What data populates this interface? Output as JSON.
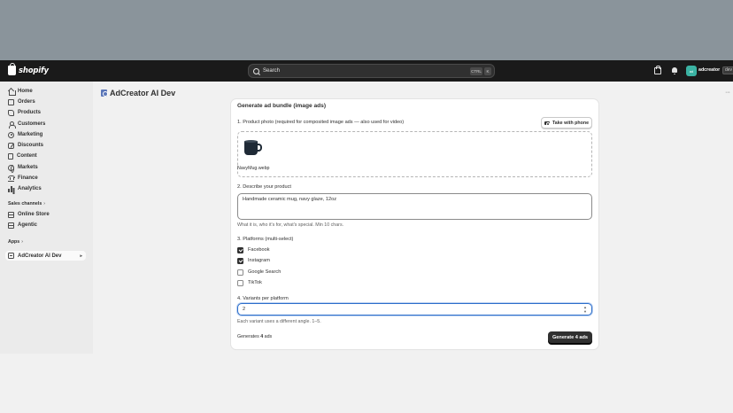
{
  "topbar": {
    "brand": "shopify",
    "search_label": "Search",
    "shortcut_mod": "CTRL",
    "shortcut_key": "K",
    "avatar_initials": "ad",
    "username": "adcreator",
    "env_badge": "dev"
  },
  "sidebar": {
    "items": [
      {
        "label": "Home",
        "icon": "home-icon"
      },
      {
        "label": "Orders",
        "icon": "orders-icon"
      },
      {
        "label": "Products",
        "icon": "tag-icon"
      },
      {
        "label": "Customers",
        "icon": "person-icon"
      },
      {
        "label": "Marketing",
        "icon": "target-icon"
      },
      {
        "label": "Discounts",
        "icon": "discount-icon"
      },
      {
        "label": "Content",
        "icon": "document-icon"
      },
      {
        "label": "Markets",
        "icon": "globe-icon"
      },
      {
        "label": "Finance",
        "icon": "bank-icon"
      },
      {
        "label": "Analytics",
        "icon": "chart-icon"
      }
    ],
    "sales_channels_label": "Sales channels",
    "channels": [
      {
        "label": "Online Store",
        "icon": "store-icon"
      },
      {
        "label": "Agentic",
        "icon": "store-icon"
      }
    ],
    "apps_label": "Apps",
    "active_app": "AdCreator AI Dev"
  },
  "main": {
    "app_title": "AdCreator AI Dev",
    "card": {
      "title": "Generate ad bundle (image ads)",
      "step1_label": "1. Product photo (required for composited image ads — also used for video)",
      "take_photo_button": "Take with phone",
      "filename": "NavyMug.webp",
      "step2_label": "2. Describe your product",
      "description_value": "Handmade ceramic mug, navy glaze, 12oz",
      "description_hint": "What it is, who it's for, what's special. Min 10 chars.",
      "step3_label": "3. Platforms (multi-select)",
      "platforms": [
        {
          "label": "Facebook",
          "checked": true
        },
        {
          "label": "Instagram",
          "checked": true
        },
        {
          "label": "Google Search",
          "checked": false
        },
        {
          "label": "TikTok",
          "checked": false
        }
      ],
      "step4_label": "4. Variants per platform",
      "variants_value": "2",
      "variants_hint": "Each variant uses a different angle. 1–5.",
      "generates_prefix": "Generates ",
      "generates_count": "4",
      "generates_suffix": " ads",
      "generate_button": "Generate 4 ads"
    }
  }
}
